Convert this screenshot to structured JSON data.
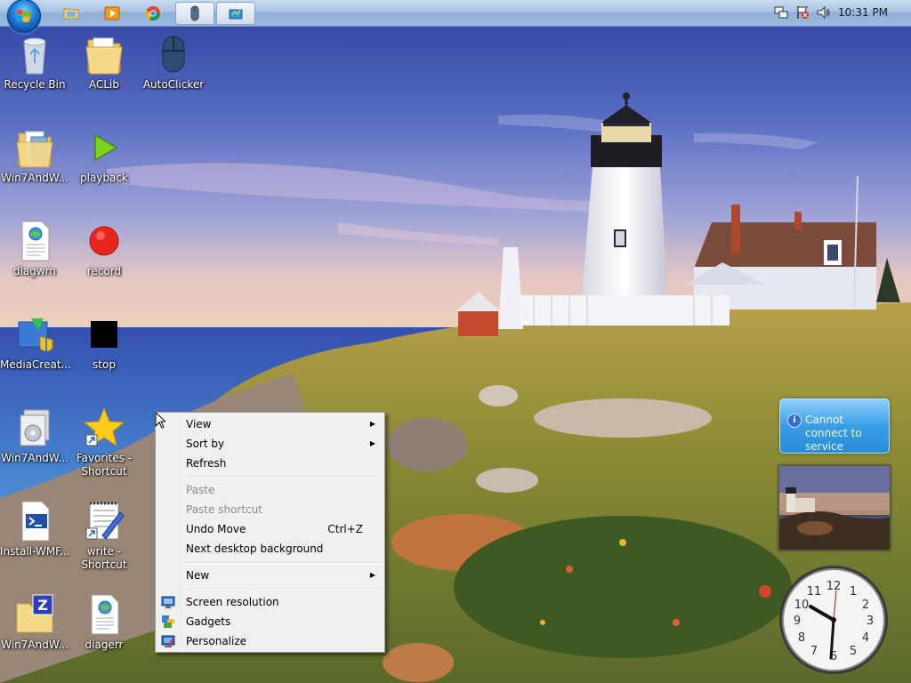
{
  "taskbar": {
    "clock": "10:31 PM",
    "pinned": [
      {
        "name": "windows-explorer-icon"
      },
      {
        "name": "media-player-icon"
      },
      {
        "name": "chrome-icon"
      },
      {
        "name": "autoclicker-mouse-icon"
      },
      {
        "name": "network-app-icon"
      }
    ],
    "tray_icons": [
      "network-icon",
      "action-center-flag-icon",
      "volume-icon"
    ]
  },
  "desktop": {
    "icons": [
      {
        "label": "Recycle Bin",
        "icon": "recycle-bin-icon"
      },
      {
        "label": "ACLib",
        "icon": "folder-icon"
      },
      {
        "label": "AutoClicker",
        "icon": "mouse-icon"
      },
      {
        "label": "Win7AndW...",
        "icon": "folder-docs-icon"
      },
      {
        "label": "playback",
        "icon": "play-icon"
      },
      {
        "label": "diagwrn",
        "icon": "document-globe-icon"
      },
      {
        "label": "record",
        "icon": "record-icon"
      },
      {
        "label": "MediaCreat...",
        "icon": "media-creation-icon"
      },
      {
        "label": "stop",
        "icon": "stop-icon"
      },
      {
        "label": "Win7AndW...",
        "icon": "installer-icon"
      },
      {
        "label": "Favorites - Shortcut",
        "icon": "star-shortcut-icon"
      },
      {
        "label": "Install-WMF...",
        "icon": "powershell-script-icon"
      },
      {
        "label": "write - Shortcut",
        "icon": "notepad-shortcut-icon"
      },
      {
        "label": "Win7AndW...",
        "icon": "zip-folder-icon"
      },
      {
        "label": "diagerr",
        "icon": "document-globe-icon"
      }
    ]
  },
  "context_menu": {
    "view": "View",
    "sort_by": "Sort by",
    "refresh": "Refresh",
    "paste": "Paste",
    "paste_shortcut": "Paste shortcut",
    "undo_move": "Undo Move",
    "undo_move_shortcut": "Ctrl+Z",
    "next_background": "Next desktop background",
    "new": "New",
    "screen_resolution": "Screen resolution",
    "gadgets": "Gadgets",
    "personalize": "Personalize"
  },
  "gadgets": {
    "weather_message": "Cannot connect to service",
    "clock_numbers": [
      "12",
      "1",
      "2",
      "3",
      "4",
      "5",
      "6",
      "7",
      "8",
      "9",
      "10",
      "11"
    ]
  },
  "colors": {
    "taskbar_top": "#c8dbef",
    "menu_bg": "#f0f0f0",
    "disabled_text": "#8a8a8a",
    "weather_blue": "#3a9ee6"
  }
}
